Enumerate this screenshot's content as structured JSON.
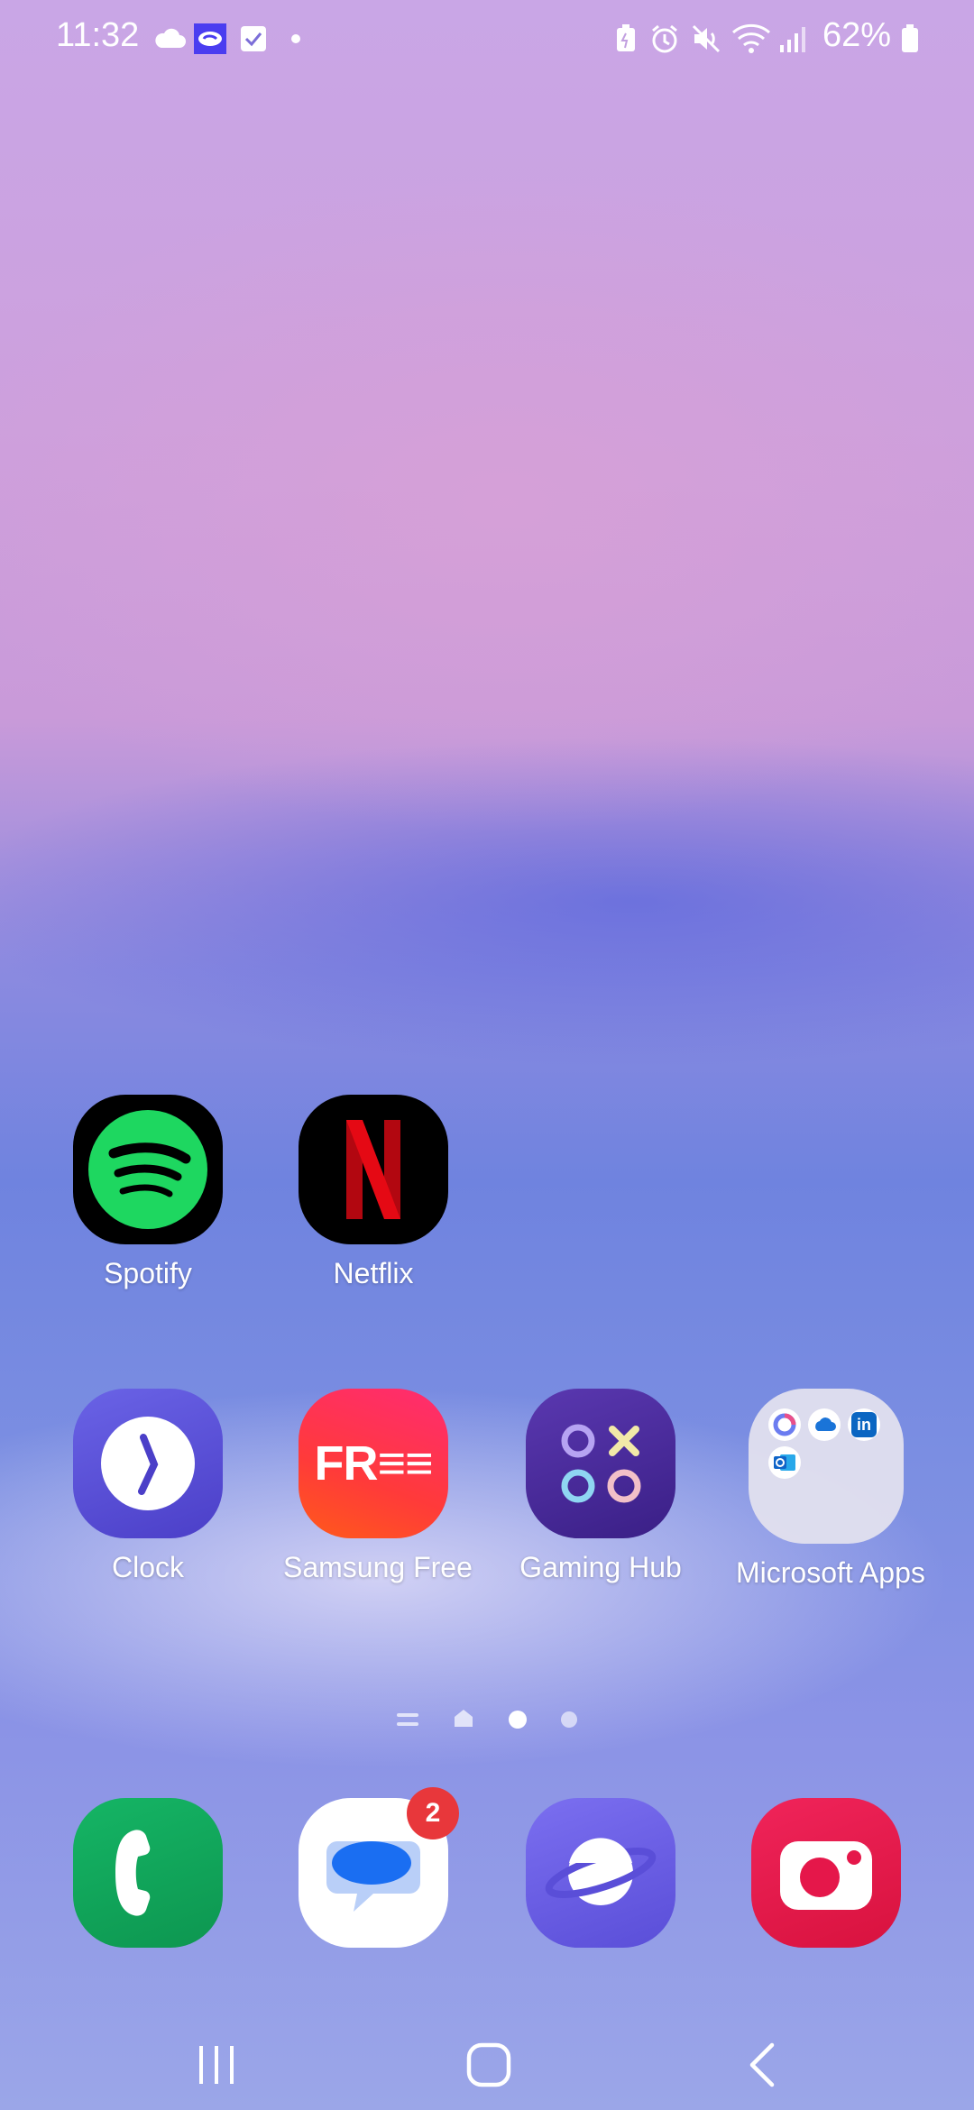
{
  "status_bar": {
    "time": "11:32",
    "battery_percent": "62%",
    "left_icons": [
      "cloud-icon",
      "app-notification-icon",
      "checkbox-icon",
      "dot-icon"
    ],
    "right_icons": [
      "battery-saver-icon",
      "alarm-icon",
      "mute-icon",
      "wifi-icon",
      "signal-icon",
      "battery-icon"
    ]
  },
  "home": {
    "row1": [
      {
        "label": "Spotify",
        "icon": "spotify-icon"
      },
      {
        "label": "Netflix",
        "icon": "netflix-icon"
      }
    ],
    "row2": [
      {
        "label": "Clock",
        "icon": "clock-icon"
      },
      {
        "label": "Samsung Free",
        "icon": "samsung-free-icon",
        "icon_text": "FR≡≡"
      },
      {
        "label": "Gaming Hub",
        "icon": "gaming-hub-icon"
      },
      {
        "label": "Microsoft Apps",
        "icon": "folder-icon"
      }
    ],
    "page_indicator": {
      "pages": [
        "list",
        "home",
        "active",
        "page"
      ],
      "active_index": 2
    }
  },
  "dock": {
    "apps": [
      {
        "name": "Phone",
        "icon": "phone-icon"
      },
      {
        "name": "Messages",
        "icon": "messages-icon",
        "badge": "2"
      },
      {
        "name": "Internet",
        "icon": "internet-icon"
      },
      {
        "name": "Camera",
        "icon": "camera-icon"
      }
    ]
  },
  "nav_bar": {
    "buttons": [
      "recent-apps",
      "home",
      "back"
    ]
  },
  "colors": {
    "spotify_bg": "#000000",
    "spotify_green": "#1ed760",
    "netflix_red": "#e50914",
    "clock_bg": "#5a54d8",
    "free_bg": "#ff2b55",
    "gaming_bg": "#4a2a9a",
    "folder_bg": "#dcdaea",
    "phone_bg": "#11a45a",
    "internet_bg": "#6c5fe8",
    "camera_bg": "#e5174a"
  }
}
